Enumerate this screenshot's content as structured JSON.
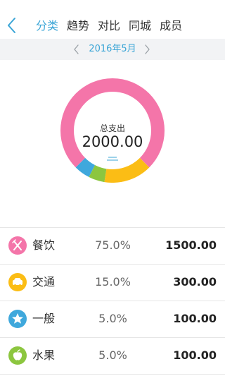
{
  "header": {
    "tabs": [
      {
        "label": "分类",
        "active": true
      },
      {
        "label": "趋势",
        "active": false
      },
      {
        "label": "对比",
        "active": false
      },
      {
        "label": "同城",
        "active": false
      },
      {
        "label": "成员",
        "active": false
      }
    ]
  },
  "month_selector": {
    "label": "2016年5月"
  },
  "summary": {
    "total_label": "总支出",
    "total_value": "2000.00",
    "currency_icon": "currency-icon"
  },
  "categories": [
    {
      "name": "餐饮",
      "percent": "75.0%",
      "amount": "1500.00",
      "color": "#f475a9",
      "icon": "utensils-icon"
    },
    {
      "name": "交通",
      "percent": "15.0%",
      "amount": "300.00",
      "color": "#fbbd15",
      "icon": "car-icon"
    },
    {
      "name": "一般",
      "percent": "5.0%",
      "amount": "100.00",
      "color": "#3fa8dc",
      "icon": "star-icon"
    },
    {
      "name": "水果",
      "percent": "5.0%",
      "amount": "100.00",
      "color": "#8cc63f",
      "icon": "apple-icon"
    }
  ],
  "chart_data": {
    "type": "pie",
    "categories": [
      "餐饮",
      "交通",
      "水果",
      "一般"
    ],
    "values": [
      75,
      15,
      5,
      5
    ],
    "colors": [
      "#f475a9",
      "#fbbd15",
      "#8cc63f",
      "#3fa8dc"
    ]
  }
}
